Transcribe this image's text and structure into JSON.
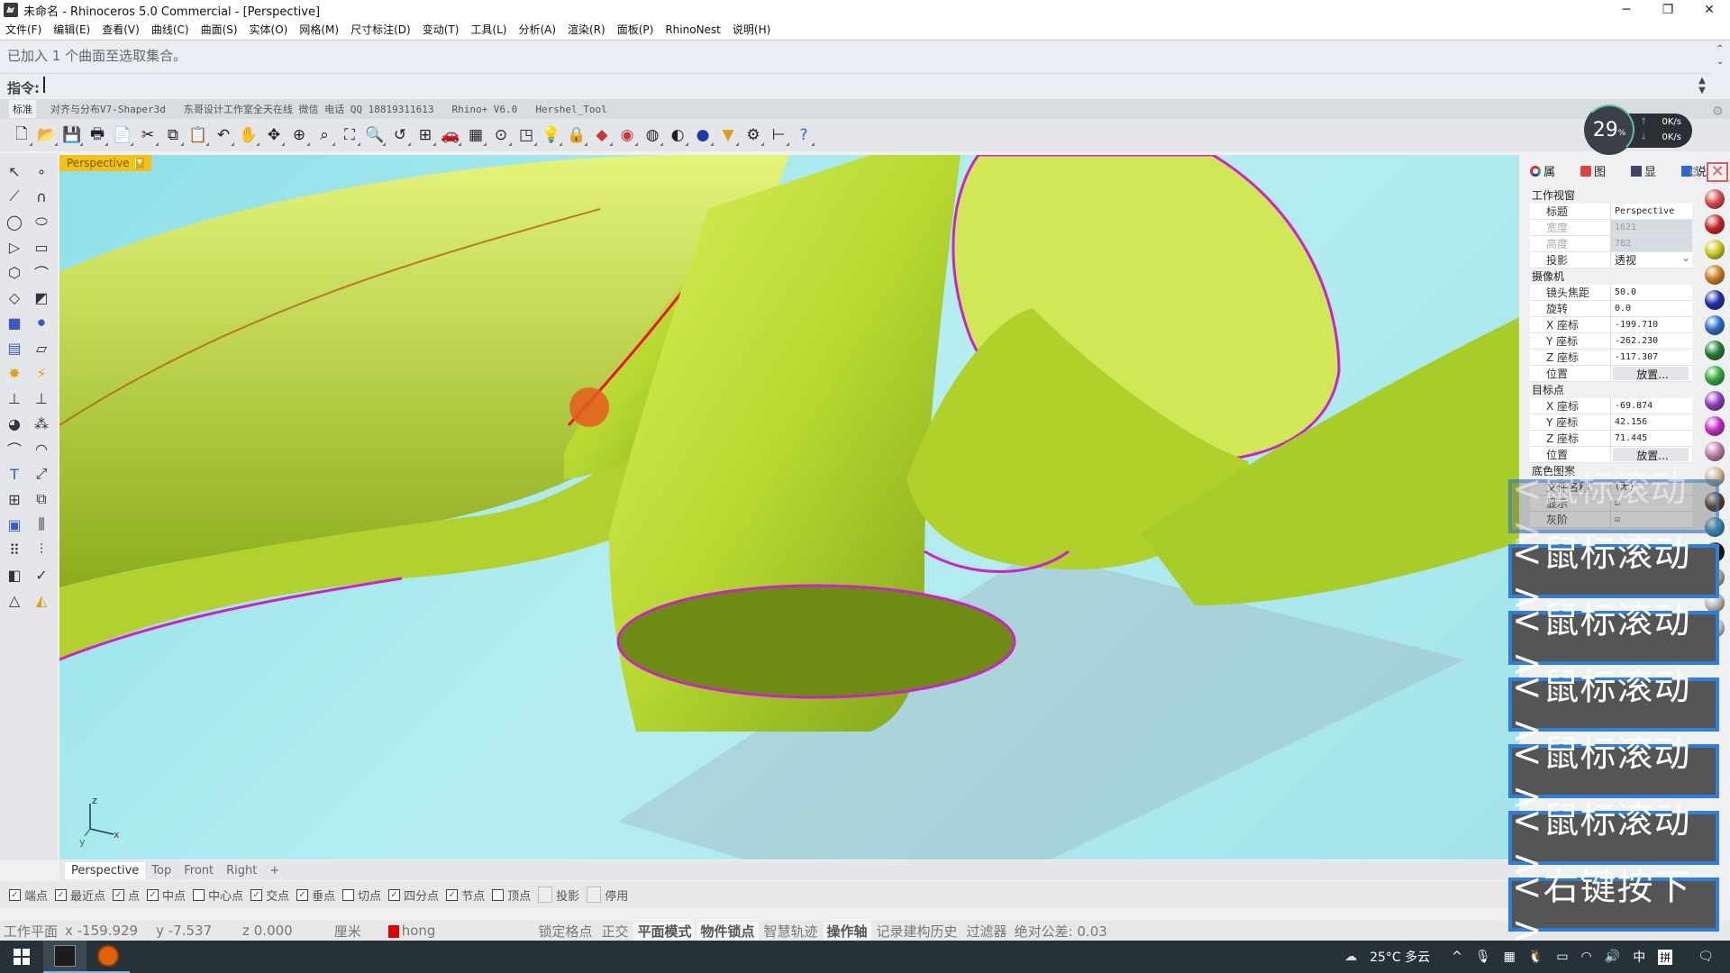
{
  "window": {
    "title": "未命名 - Rhinoceros 5.0 Commercial - [Perspective]",
    "controls": [
      "minimize",
      "restore",
      "close"
    ]
  },
  "menubar": {
    "items": [
      "文件(F)",
      "编辑(E)",
      "查看(V)",
      "曲线(C)",
      "曲面(S)",
      "实体(O)",
      "网格(M)",
      "尺寸标注(D)",
      "变动(T)",
      "工具(L)",
      "分析(A)",
      "渲染(R)",
      "面板(P)",
      "RhinoNest",
      "说明(H)"
    ]
  },
  "command": {
    "history": "已加入 1 个曲面至选取集合。",
    "prompt": "指令:",
    "value": ""
  },
  "toolbar_tabs": [
    "标准",
    "对齐与分布V7-Shaper3d",
    "东哥设计工作室全天在线 微信 电话 QQ 18819311613",
    "Rhino+ V6.0",
    "Hershel_Tool"
  ],
  "toolbar_icons": [
    "new-icon",
    "open-icon",
    "save-icon",
    "print-icon",
    "import-icon",
    "cut-icon",
    "copy-icon",
    "paste-icon",
    "undo-icon",
    "pan-icon",
    "rotate-view-icon",
    "zoom-in-out-icon",
    "zoom-window-icon",
    "zoom-extents-icon",
    "zoom-selected-icon",
    "undo-view-icon",
    "four-viewports-icon",
    "car-icon",
    "grid-icon",
    "cplane-icon",
    "snap-icon",
    "light-icon",
    "lock-icon",
    "layer-icon",
    "color-wheel-icon",
    "wireframe-sphere-icon",
    "shaded-sphere-icon",
    "rendered-sphere-icon",
    "render-icon",
    "options-gear-icon",
    "dimension-icon",
    "help-icon"
  ],
  "perf": {
    "cpu_percent": "29",
    "cpu_unit": "%",
    "upload": "0K/s",
    "download": "0K/s"
  },
  "left_tools": [
    "select-icon",
    "point-icon",
    "polyline-icon",
    "curve-icon",
    "circle-icon",
    "ellipse-icon",
    "polygon-icon",
    "rectangle-icon",
    "hexagon-icon",
    "fillet-curve-icon",
    "surface-corner-icon",
    "loft-icon",
    "box-icon",
    "sphere-union-icon",
    "extrude-icon",
    "surface-edit-icon",
    "explode-icon",
    "split-icon",
    "trim-icon",
    "extend-icon",
    "boolean-icon",
    "points-icon",
    "arc-icon",
    "offset-icon",
    "text-icon",
    "scale-icon",
    "array-icon",
    "align-icon",
    "solid-edit-icon",
    "planar-icon",
    "array-grid-icon",
    "history-icon",
    "mirror-icon",
    "check-icon",
    "primitives-icon",
    "render-mat-icon"
  ],
  "viewport": {
    "label": "Perspective",
    "axes": {
      "z": "z",
      "x": "x",
      "y": "y"
    }
  },
  "view_tabs": [
    "Perspective",
    "Top",
    "Front",
    "Right",
    "+"
  ],
  "osnaps": [
    {
      "label": "端点",
      "checked": true
    },
    {
      "label": "最近点",
      "checked": true
    },
    {
      "label": "点",
      "checked": true
    },
    {
      "label": "中点",
      "checked": true
    },
    {
      "label": "中心点",
      "checked": false
    },
    {
      "label": "交点",
      "checked": true
    },
    {
      "label": "垂点",
      "checked": true
    },
    {
      "label": "切点",
      "checked": false
    },
    {
      "label": "四分点",
      "checked": true
    },
    {
      "label": "节点",
      "checked": true
    },
    {
      "label": "顶点",
      "checked": false
    },
    {
      "label": "投影",
      "checked": false,
      "disabled": true
    },
    {
      "label": "停用",
      "checked": false,
      "disabled": true
    }
  ],
  "status": {
    "cplane": "工作平面",
    "x": "x -159.929",
    "y": "y -7.537",
    "z": "z 0.000",
    "units": "厘米",
    "layer": "hong",
    "layer_color": "#e00000",
    "panes": [
      {
        "label": "锁定格点",
        "on": false
      },
      {
        "label": "正交",
        "on": false
      },
      {
        "label": "平面模式",
        "on": true
      },
      {
        "label": "物件锁点",
        "on": true
      },
      {
        "label": "智慧轨迹",
        "on": false
      },
      {
        "label": "操作轴",
        "on": true
      },
      {
        "label": "记录建构历史",
        "on": false
      },
      {
        "label": "过滤器",
        "on": false
      }
    ],
    "tolerance": "绝对公差: 0.03"
  },
  "right_panel": {
    "tabs": [
      "属",
      "图",
      "显",
      "说"
    ],
    "sections": {
      "viewport": "工作视窗",
      "camera": "摄像机",
      "target": "目标点",
      "wallpaper": "底色图案"
    },
    "viewport_props": [
      {
        "k": "标题",
        "v": "Perspective",
        "ro": false
      },
      {
        "k": "宽度",
        "v": "1621",
        "ro": true
      },
      {
        "k": "高度",
        "v": "782",
        "ro": true
      },
      {
        "k": "投影",
        "v": "透视",
        "ro": false,
        "select": true
      }
    ],
    "camera_props": [
      {
        "k": "镜头焦距",
        "v": "50.0"
      },
      {
        "k": "旋转",
        "v": "0.0"
      },
      {
        "k": "X 座标",
        "v": "-199.710"
      },
      {
        "k": "Y 座标",
        "v": "-262.230"
      },
      {
        "k": "Z 座标",
        "v": "-117.307"
      },
      {
        "k": "位置",
        "v": "放置...",
        "btn": true
      }
    ],
    "target_props": [
      {
        "k": "X 座标",
        "v": "-69.874"
      },
      {
        "k": "Y 座标",
        "v": "42.156"
      },
      {
        "k": "Z 座标",
        "v": "71.445"
      },
      {
        "k": "位置",
        "v": "放置...",
        "btn": true
      }
    ],
    "wallpaper_props": [
      {
        "k": "文件名称",
        "v": "(无)"
      },
      {
        "k": "显示",
        "v": "☑"
      },
      {
        "k": "灰阶",
        "v": "☑"
      }
    ],
    "materials": [
      "#d84a4a",
      "#c62020",
      "#c8c820",
      "#cc7a18",
      "#1a2aa8",
      "#2a6ac8",
      "#1e7a30",
      "#2aa83a",
      "#8a3ab8",
      "#c02ac0",
      "#b87aa8",
      "#c8b890",
      "#5a3a2a",
      "#2a8aa8",
      "#111111",
      "#a8a8a8",
      "#b8b8b8",
      "#c8c8c8"
    ]
  },
  "overlays": {
    "faint": "<鼠标滚动>",
    "buttons": [
      "<鼠标滚动>",
      "<鼠标滚动>",
      "<鼠标滚动>",
      "<鼠标滚动>",
      "<鼠标滚动>",
      "<右键按下>"
    ]
  },
  "taskbar": {
    "weather": "25°C 多云",
    "ime": "中",
    "ime2": "拼"
  }
}
